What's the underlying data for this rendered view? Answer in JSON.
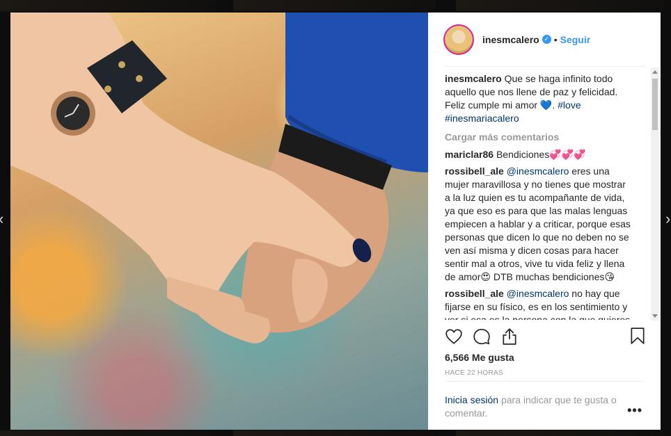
{
  "post": {
    "username": "inesmcalero",
    "verified_mark": "✓",
    "separator": "•",
    "follow_label": "Seguir",
    "caption": {
      "user": "inesmcalero",
      "text": "Que se haga infinito todo aquello que nos llene de paz y felicidad. Feliz cumple mi amor",
      "emoji": "💙",
      "dot": ".",
      "hashtag1": "#love",
      "hashtag2": "#inesmariacalero"
    },
    "load_more_label": "Cargar más comentarios",
    "comments": [
      {
        "user": "mariclar86",
        "text": "Bendiciones💞💞💞"
      },
      {
        "user": "rossibell_ale",
        "mention": "@inesmcalero",
        "text": "eres una mujer maravillosa y no tienes que mostrar a la luz quien es tu acompañante de vida, ya que eso es para que las malas lenguas empiecen a hablar y a criticar, porque esas personas que dicen lo que no deben no se ven así misma y dicen cosas para hacer sentir mal a otros, vive tu vida feliz y llena de amor😍 DTB muchas bendiciones😘"
      },
      {
        "user": "rossibell_ale",
        "mention": "@inesmcalero",
        "text": "no hay que fijarse en su físico, es en los sentimiento y ver si esa es la persona con la que quieres"
      }
    ],
    "likes": "6,566 Me gusta",
    "time": "HACE 22 HORAS",
    "login_link": "Inicia sesión",
    "login_rest": "para indicar que te gusta o comentar.",
    "more_label": "•••"
  },
  "icons": {
    "like": "heart-icon",
    "comment": "comment-icon",
    "share": "share-icon",
    "save": "bookmark-icon"
  },
  "colors": {
    "accent": "#3897f0",
    "link": "#003569",
    "muted": "#999999",
    "avatar_ring": "#d6249f"
  }
}
